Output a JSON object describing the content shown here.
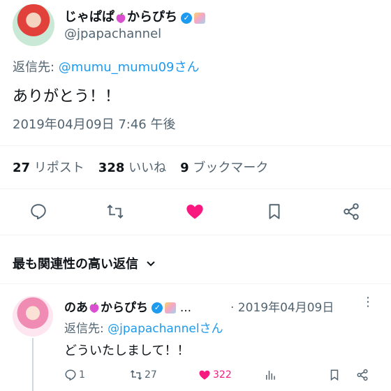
{
  "tweet": {
    "name": "じゃぱぱ",
    "name_suffix": "からぴち",
    "handle": "@jpapachannel",
    "reply_prefix": "返信先: ",
    "reply_to": "@mumu_mumu09さん",
    "text": "ありがとう！！",
    "timestamp": "2019年04月09日 7:46 午後",
    "stats": {
      "reposts_count": "27",
      "reposts_label": "リポスト",
      "likes_count": "328",
      "likes_label": "いいね",
      "bookmarks_count": "9",
      "bookmarks_label": "ブックマーク"
    },
    "liked_color": "#f91880"
  },
  "sort": {
    "label": "最も関連性の高い返信"
  },
  "reply": {
    "name": "のあ",
    "name_suffix": "からぴち",
    "ellipsis": "...",
    "date": "· 2019年04月09日",
    "reply_prefix": "返信先: ",
    "reply_to": "@jpapachannelさん",
    "text": "どういたしまして！！",
    "replies": "1",
    "reposts": "27",
    "likes": "322"
  },
  "colors": {
    "accent": "#1d9bf0",
    "like": "#f91880",
    "muted": "#536471"
  }
}
